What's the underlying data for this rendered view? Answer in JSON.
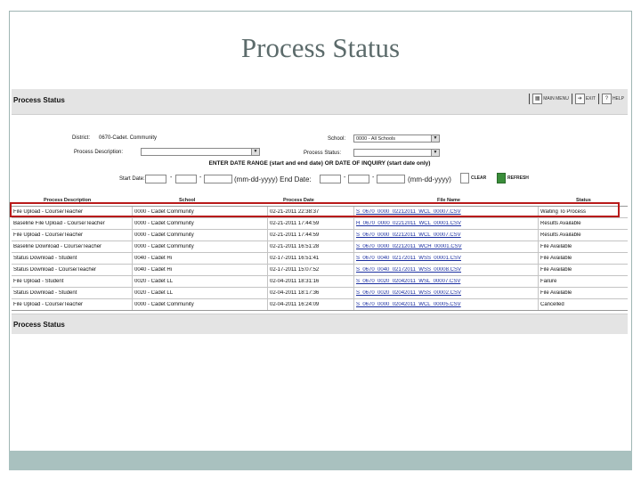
{
  "slide": {
    "title": "Process Status"
  },
  "app": {
    "header_title": "Process Status",
    "footer_title": "Process Status",
    "nav": [
      {
        "label": "MAIN MENU",
        "icon": "main-menu-icon"
      },
      {
        "label": "EXIT",
        "icon": "exit-icon"
      },
      {
        "label": "HELP",
        "icon": "help-icon"
      }
    ]
  },
  "filters": {
    "district_label": "District:",
    "district_value": "0670-Cadet. Community",
    "school_label": "School:",
    "school_value": "0000 - All Schools",
    "process_description_label": "Process Description:",
    "process_description_value": "",
    "process_status_label": "Process Status:",
    "process_status_value": "",
    "date_range_text": "ENTER DATE RANGE (start and end date) OR DATE OF INQUIRY (start date only)",
    "start_date_label": "Start Date:",
    "end_date_label": "End Date:",
    "date_format": "(mm-dd-yyyy)",
    "start_date_format_inline": "(mm-dd-yyyy) End Date:",
    "clear_label": "CLEAR",
    "refresh_label": "REFRESH"
  },
  "table": {
    "columns": [
      "Process Description",
      "School",
      "Process Date",
      "File Name",
      "Status"
    ],
    "rows": [
      [
        "File Upload - Course/Teacher",
        "0000 - Cadet Community",
        "02-21-2011 22:38:37",
        "S_0670_0000_02212011_WCL_00007.CSV",
        "Waiting To Process"
      ],
      [
        "Baseline File Upload - Course/Teacher",
        "0000 - Cadet Community",
        "02-21-2011 17:44:59",
        "H_0670_0000_02212011_WCL_00001.CSV",
        "Results Available"
      ],
      [
        "File Upload - Course/Teacher",
        "0000 - Cadet Community",
        "02-21-2011 17:44:59",
        "S_0670_0000_02212011_WCL_00007.CSV",
        "Results Available"
      ],
      [
        "Baseline Download - Course/Teacher",
        "0000 - Cadet Community",
        "02-21-2011 16:51:28",
        "S_0670_0000_02212011_WCH_00001.CSV",
        "File Available"
      ],
      [
        "Status Download - Student",
        "0040 - Cadet Hi",
        "02-17-2011 16:51:41",
        "S_0670_0040_02172011_WSS_00001.CSV",
        "File Available"
      ],
      [
        "Status Download - Course/Teacher",
        "0040 - Cadet Hi",
        "02-17-2011 15:07:52",
        "S_0670_0040_02172011_WSS_00008.CSV",
        "File Available"
      ],
      [
        "File Upload - Student",
        "0020 - Cadet LL",
        "02-04-2011 18:31:16",
        "S_0670_0020_02042011_WSL_00007.CSV",
        "Failure"
      ],
      [
        "Status Download - Student",
        "0020 - Cadet LL",
        "02-04-2011 18:17:36",
        "S_0670_0020_02042011_WSS_00002.CSV",
        "File Available"
      ],
      [
        "File Upload - Course/Teacher",
        "0000 - Cadet Community",
        "02-04-2011 16:24:09",
        "S_0670_0000_02042011_WCL_00005.CSV",
        "Cancelled"
      ]
    ]
  },
  "colors": {
    "highlight": "#b81b1b",
    "link": "#1a2ea0",
    "slide_bar": "#a9c1bf",
    "header_bg": "#e4e4e4"
  }
}
